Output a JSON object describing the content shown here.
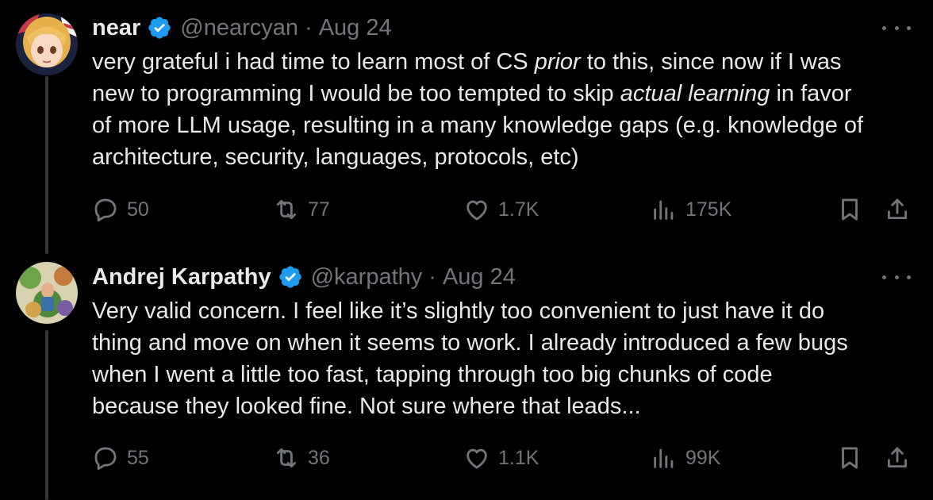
{
  "tweets": [
    {
      "name": "near",
      "handle": "@nearcyan",
      "sep": "·",
      "date": "Aug 24",
      "verified_icon": "verified-badge-icon",
      "text_lines": [
        [
          "very grateful i had time to learn most of CS ",
          "prior",
          " to this, since now if I was"
        ],
        [
          "new to programming I would be too tempted to skip ",
          "actual learning",
          " in favor"
        ],
        [
          "of more LLM usage, resulting in a many knowledge gaps (e.g. knowledge of"
        ],
        [
          "architecture, security, languages, protocols, etc)"
        ]
      ],
      "replies": "50",
      "reposts": "77",
      "likes": "1.7K",
      "views": "175K"
    },
    {
      "name": "Andrej Karpathy",
      "handle": "@karpathy",
      "sep": "·",
      "date": "Aug 24",
      "verified_icon": "verified-badge-icon",
      "text_lines": [
        [
          "Very valid concern. I feel like it’s slightly too convenient to just have it do"
        ],
        [
          "thing and move on when it seems to work. I already introduced a few bugs"
        ],
        [
          "when I went a little too fast, tapping through too big chunks of code"
        ],
        [
          "because they looked fine. Not sure where that leads..."
        ]
      ],
      "replies": "55",
      "reposts": "36",
      "likes": "1.1K",
      "views": "99K"
    }
  ],
  "colors": {
    "background": "#000000",
    "text": "#e7e9ea",
    "secondary": "#71767b",
    "verified": "#1d9bf0",
    "thread_line": "#333639"
  },
  "icons": [
    "reply-icon",
    "repost-icon",
    "like-icon",
    "views-icon",
    "bookmark-icon",
    "share-icon",
    "more-icon"
  ]
}
